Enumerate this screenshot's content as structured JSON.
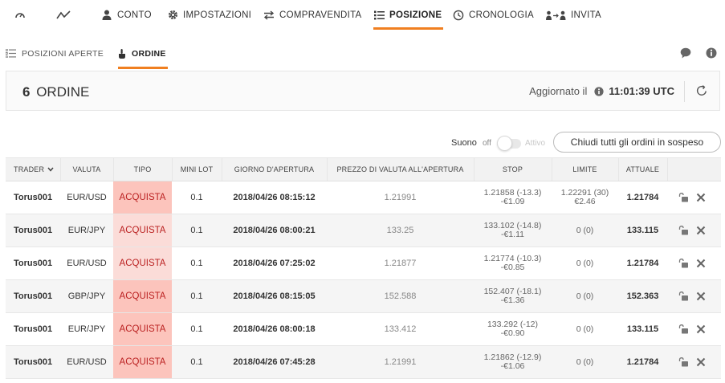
{
  "nav": {
    "items": [
      {
        "label": "",
        "icon": "gauge-icon"
      },
      {
        "label": "",
        "icon": "trend-icon"
      },
      {
        "label": "CONTO",
        "icon": "user-icon"
      },
      {
        "label": "IMPOSTAZIONI",
        "icon": "gear-icon"
      },
      {
        "label": "COMPRAVENDITA",
        "icon": "swap-icon"
      },
      {
        "label": "POSIZIONE",
        "icon": "list-icon"
      },
      {
        "label": "CRONOLOGIA",
        "icon": "clock-icon"
      },
      {
        "label": "INVITA",
        "icon": "invite-icon"
      }
    ],
    "active": "POSIZIONE",
    "accent": "#f07f20"
  },
  "subnav": {
    "open_positions_label": "POSIZIONI APERTE",
    "order_label": "ORDINE"
  },
  "header": {
    "count": "6",
    "title": "ORDINE",
    "updated_label": "Aggiornato il",
    "updated_time": "11:01:39 UTC"
  },
  "sound": {
    "label": "Suono",
    "off": "off",
    "on": "Attivo",
    "close_all_label": "Chiudi tutti gli ordini in sospeso"
  },
  "table": {
    "columns": {
      "trader": "TRADER",
      "currency": "VALUTA",
      "type": "TIPO",
      "mini_lot": "MINI LOT",
      "open_day": "GIORNO D'APERTURA",
      "open_price": "PREZZO DI VALUTA ALL'APERTURA",
      "stop": "STOP",
      "limit": "LIMITE",
      "current": "ATTUALE"
    },
    "rows": [
      {
        "trader": "Torus001",
        "currency": "EUR/USD",
        "type": "ACQUISTA",
        "mini_lot": "0.1",
        "open_day": "2018/04/26 08:15:12",
        "open_price": "1.21991",
        "stop_1": "1.21858 (-13.3)",
        "stop_2": "-€1.09",
        "limit_1": "1.22291 (30)",
        "limit_2": "€2.46",
        "current": "1.21784"
      },
      {
        "trader": "Torus001",
        "currency": "EUR/JPY",
        "type": "ACQUISTA",
        "mini_lot": "0.1",
        "open_day": "2018/04/26 08:00:21",
        "open_price": "133.25",
        "stop_1": "133.102 (-14.8)",
        "stop_2": "-€1.11",
        "limit_1": "0 (0)",
        "limit_2": "",
        "current": "133.115"
      },
      {
        "trader": "Torus001",
        "currency": "EUR/USD",
        "type": "ACQUISTA",
        "mini_lot": "0.1",
        "open_day": "2018/04/26 07:25:02",
        "open_price": "1.21877",
        "stop_1": "1.21774 (-10.3)",
        "stop_2": "-€0.85",
        "limit_1": "0 (0)",
        "limit_2": "",
        "current": "1.21784"
      },
      {
        "trader": "Torus001",
        "currency": "GBP/JPY",
        "type": "ACQUISTA",
        "mini_lot": "0.1",
        "open_day": "2018/04/26 08:15:05",
        "open_price": "152.588",
        "stop_1": "152.407 (-18.1)",
        "stop_2": "-€1.36",
        "limit_1": "0 (0)",
        "limit_2": "",
        "current": "152.363"
      },
      {
        "trader": "Torus001",
        "currency": "EUR/JPY",
        "type": "ACQUISTA",
        "mini_lot": "0.1",
        "open_day": "2018/04/26 08:00:18",
        "open_price": "133.412",
        "stop_1": "133.292 (-12)",
        "stop_2": "-€0.90",
        "limit_1": "0 (0)",
        "limit_2": "",
        "current": "133.115"
      },
      {
        "trader": "Torus001",
        "currency": "EUR/USD",
        "type": "ACQUISTA",
        "mini_lot": "0.1",
        "open_day": "2018/04/26 07:45:28",
        "open_price": "1.21991",
        "stop_1": "1.21862 (-12.9)",
        "stop_2": "-€1.06",
        "limit_1": "0 (0)",
        "limit_2": "",
        "current": "1.21784"
      }
    ],
    "row_actions": [
      "lock-icon",
      "close-icon"
    ]
  }
}
